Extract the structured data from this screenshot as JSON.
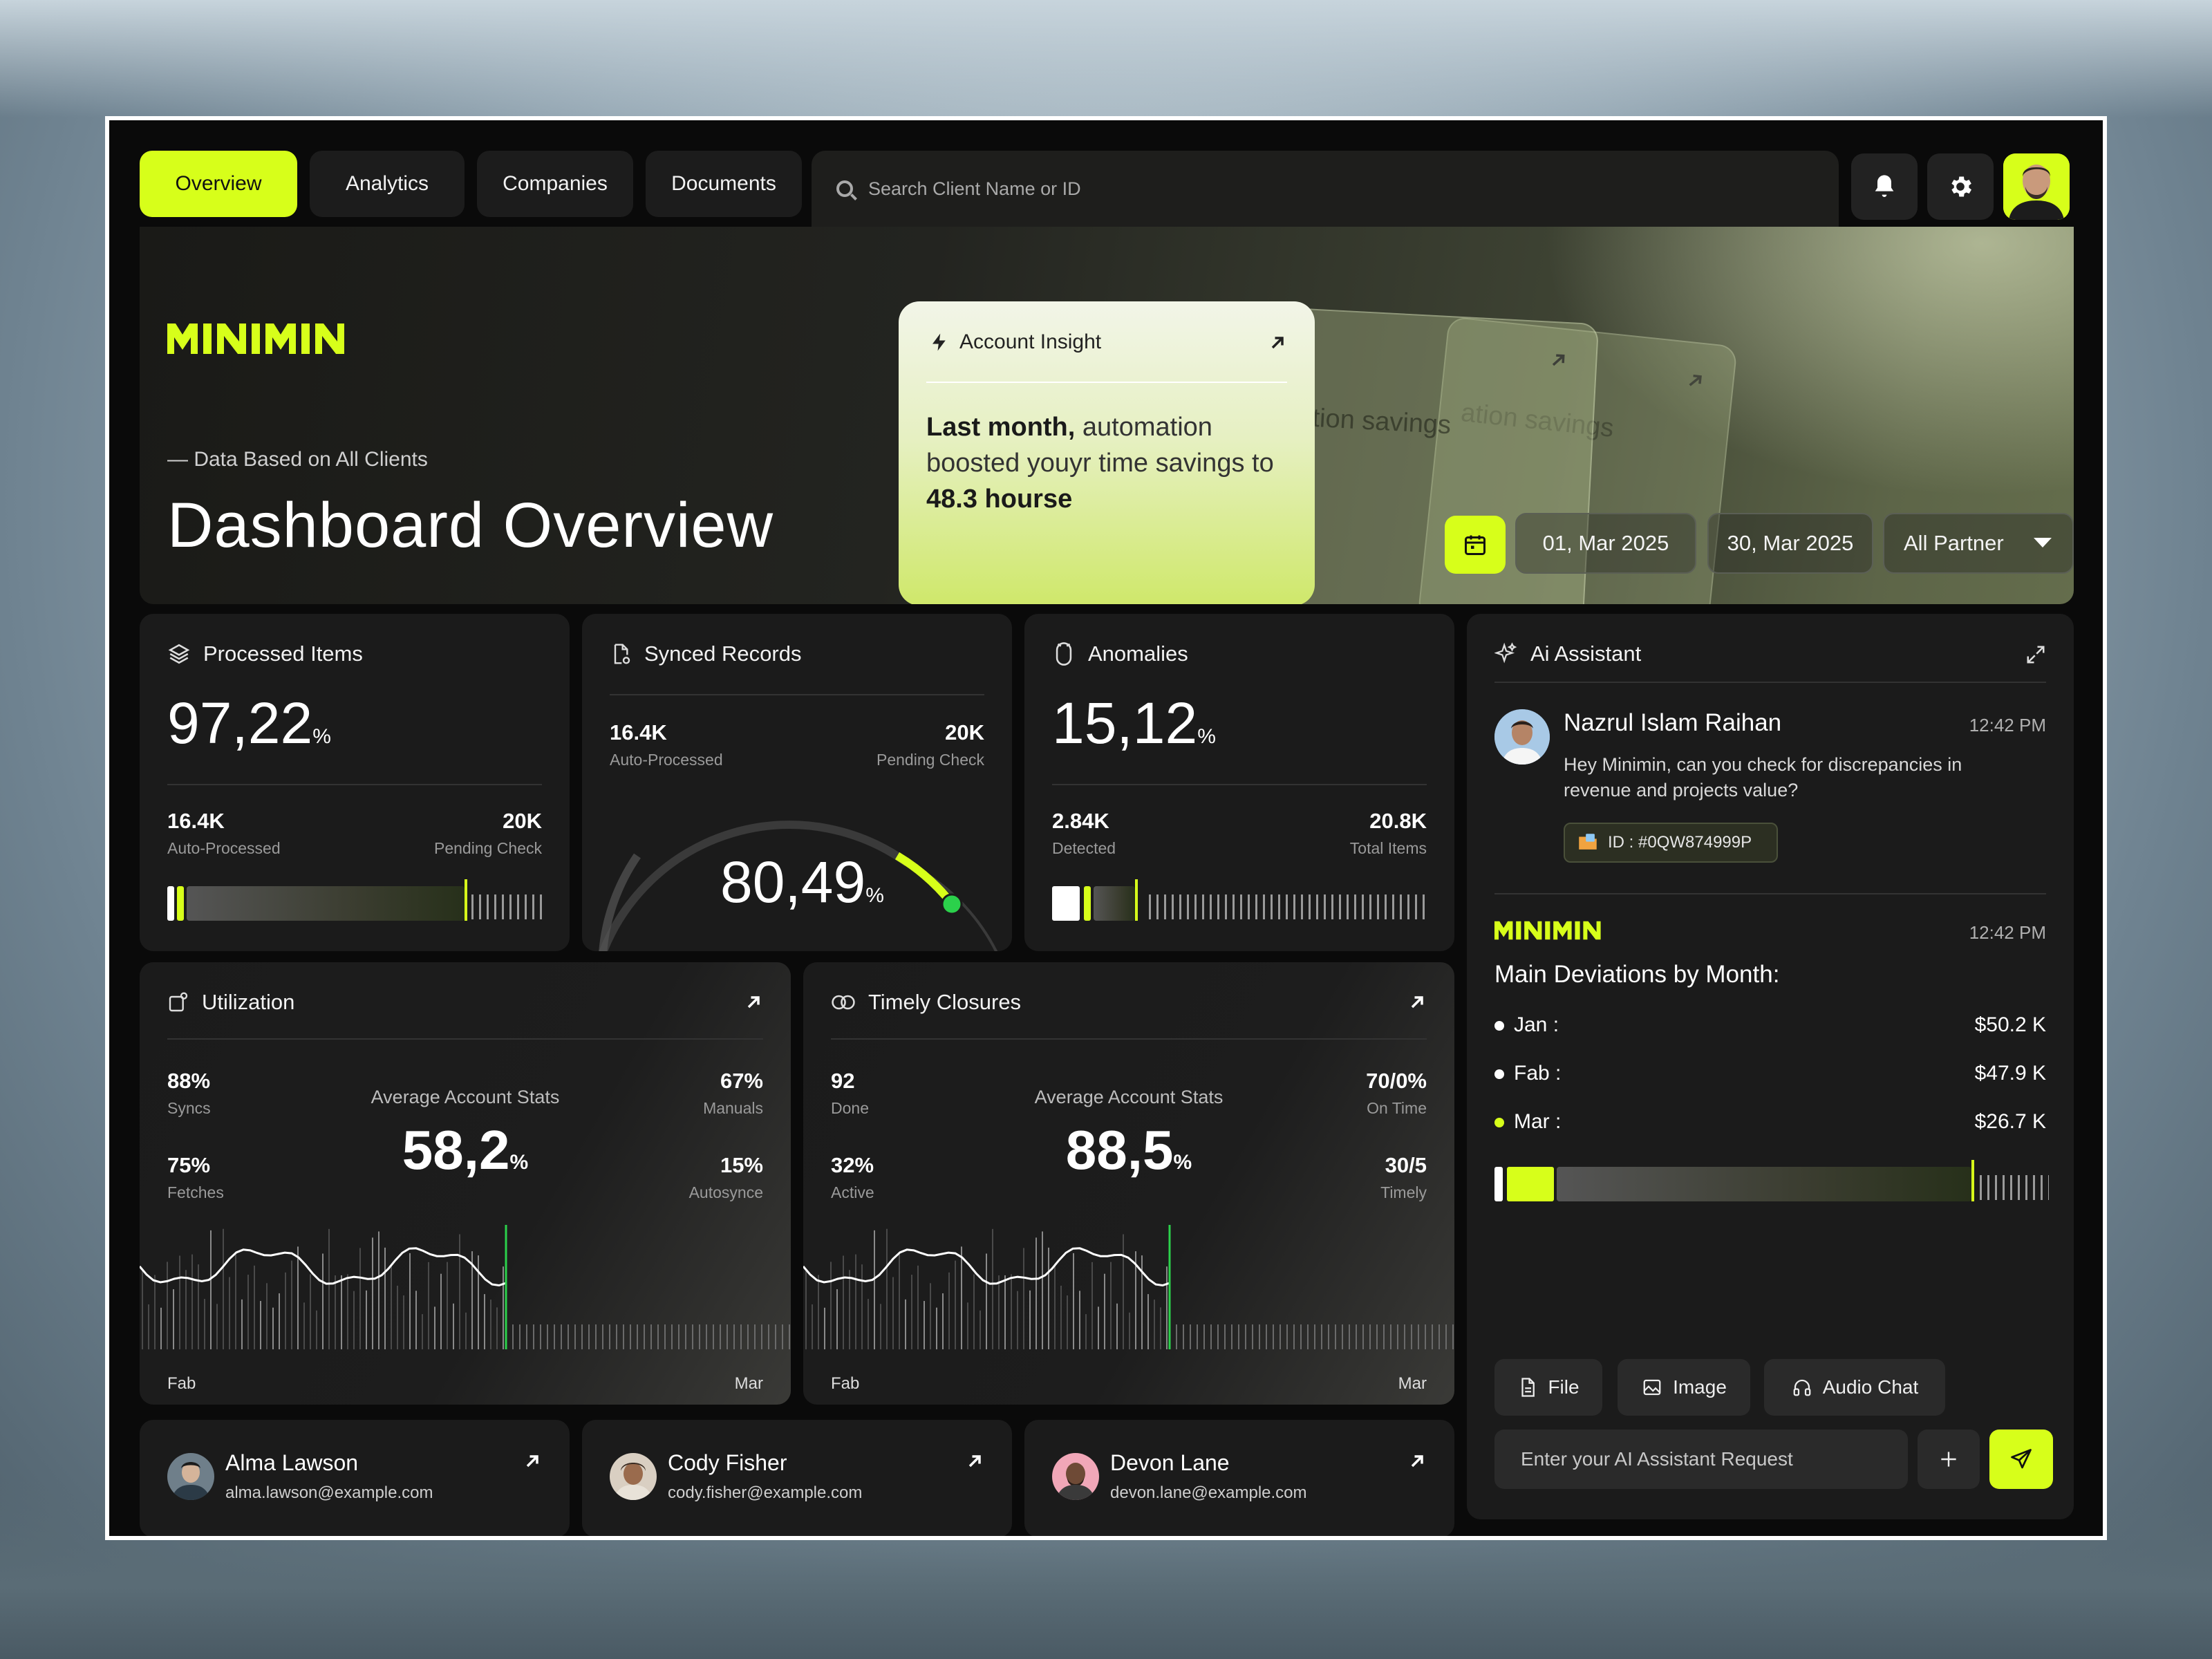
{
  "nav": {
    "tabs": [
      "Overview",
      "Analytics",
      "Companies",
      "Documents"
    ],
    "search_placeholder": "Search Client Name or ID"
  },
  "hero": {
    "logo": "MINIMIN",
    "subtitle": "— Data Based on All Clients",
    "title": "Dashboard Overview",
    "insight": {
      "title": "Account Insight",
      "text_bold_1": "Last month,",
      "text_1": " automation boosted youyr time savings to ",
      "text_bold_2": "48.3 hourse"
    },
    "back_card_text_1": "ation savings",
    "back_card_text_2": "ation savings",
    "date_from": "01, Mar 2025",
    "date_to": "30, Mar 2025",
    "partner_filter": "All Partner"
  },
  "processed": {
    "title": "Processed Items",
    "value": "97,22",
    "unit": "%",
    "left_value": "16.4K",
    "left_label": "Auto-Processed",
    "right_value": "20K",
    "right_label": "Pending Check"
  },
  "synced": {
    "title": "Synced Records",
    "value": "80,49",
    "unit": "%",
    "left_value": "16.4K",
    "left_label": "Auto-Processed",
    "right_value": "20K",
    "right_label": "Pending Check"
  },
  "anomalies": {
    "title": "Anomalies",
    "value": "15,12",
    "unit": "%",
    "left_value": "2.84K",
    "left_label": "Detected",
    "right_value": "20.8K",
    "right_label": "Total Items"
  },
  "utilization": {
    "title": "Utilization",
    "center_label": "Average Account Stats",
    "value": "58,2",
    "unit": "%",
    "stats": [
      {
        "value": "88%",
        "label": "Syncs"
      },
      {
        "value": "67%",
        "label": "Manuals"
      },
      {
        "value": "75%",
        "label": "Fetches"
      },
      {
        "value": "15%",
        "label": "Autosynce"
      }
    ],
    "x_start": "Fab",
    "x_end": "Mar"
  },
  "timely": {
    "title": "Timely Closures",
    "center_label": "Average Account Stats",
    "value": "88,5",
    "unit": "%",
    "stats": [
      {
        "value": "92",
        "label": "Done"
      },
      {
        "value": "70/0%",
        "label": "On Time"
      },
      {
        "value": "32%",
        "label": "Active"
      },
      {
        "value": "30/5",
        "label": "Timely"
      }
    ],
    "x_start": "Fab",
    "x_end": "Mar"
  },
  "assistant": {
    "title": "Ai Assistant",
    "user_name": "Nazrul Islam Raihan",
    "user_time": "12:42 PM",
    "user_message": "Hey Minimin, can you check for discrepancies in revenue and projects value?",
    "id_chip": "ID : #0QW874999P",
    "bot_name": "MINIMIN",
    "bot_time": "12:42 PM",
    "bot_heading": "Main Deviations by Month:",
    "deviations": [
      {
        "month": "Jan :",
        "value": "$50.2 K"
      },
      {
        "month": "Fab :",
        "value": "$47.9 K"
      },
      {
        "month": "Mar :",
        "value": "$26.7 K"
      }
    ],
    "buttons": [
      "File",
      "Image",
      "Audio Chat"
    ],
    "input_placeholder": "Enter your AI Assistant Request"
  },
  "contacts": [
    {
      "name": "Alma Lawson",
      "email": "alma.lawson@example.com"
    },
    {
      "name": "Cody Fisher",
      "email": "cody.fisher@example.com"
    },
    {
      "name": "Devon Lane",
      "email": "devon.lane@example.com"
    }
  ],
  "colors": {
    "accent": "#d7ff1a",
    "panel": "#1b1b1b",
    "background": "#0a0a0a"
  }
}
